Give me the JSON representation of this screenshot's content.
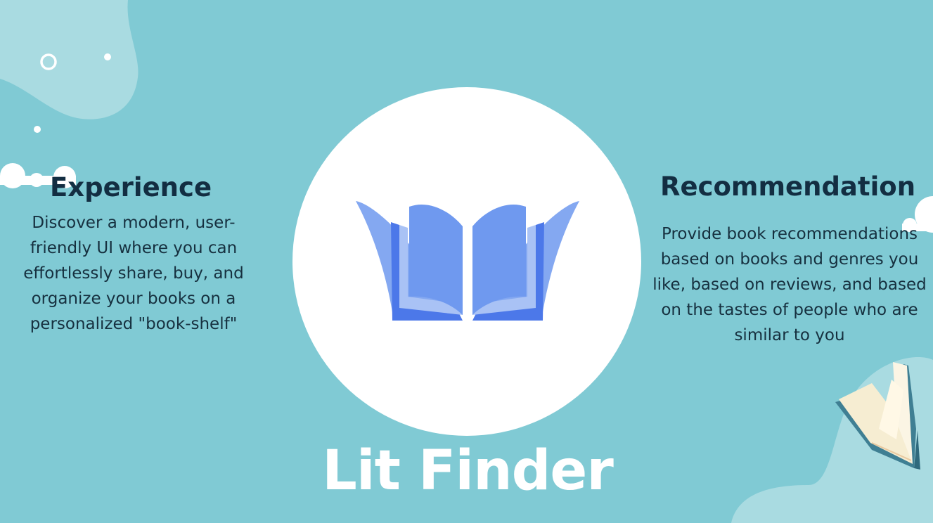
{
  "left_panel": {
    "heading": "Experience",
    "description": "Discover a modern, user-friendly UI where you can effortlessly share, buy, and organize your books on a personalized \"book-shelf\""
  },
  "right_panel": {
    "heading": "Recommendation",
    "description": "Provide book recommendations based on books and genres you like, based on reviews, and based on the tastes of people who are similar to you"
  },
  "app_title": "Lit Finder",
  "logo_icon": "open-book-icon",
  "colors": {
    "background": "#80cad4",
    "heading": "#132e42",
    "logo_blue": "#5a86ec",
    "title": "#ffffff"
  }
}
